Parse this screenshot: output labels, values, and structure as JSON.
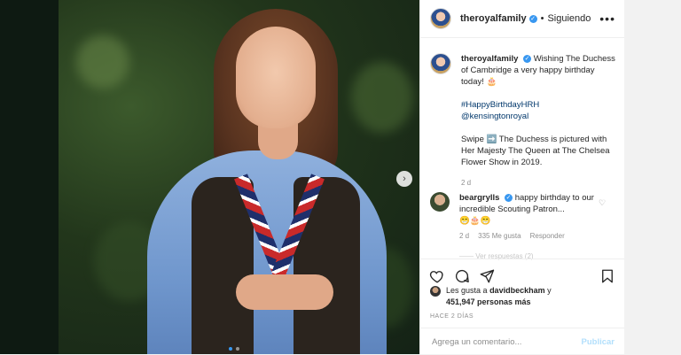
{
  "post": {
    "photo_alt": "",
    "carousel": {
      "count": 2,
      "active_index": 0
    },
    "icons": {
      "next": "chevron-right-icon"
    }
  },
  "header": {
    "username": "theroyalfamily",
    "separator": "•",
    "follow_status": "Siguiendo",
    "more_icon": "ellipsis-icon",
    "verified": true
  },
  "caption": {
    "username": "theroyalfamily",
    "text_1": "Wishing The Duchess of Cambridge a very happy birthday today! 🎂",
    "hashtag": "#HappyBirthdayHRH",
    "mention": "@kensingtonroyal",
    "text_2": "Swipe ➡️ The Duchess is pictured with Her Majesty The Queen at The Chelsea Flower Show in 2019.",
    "time": "2 d"
  },
  "comment": {
    "username": "beargrylls",
    "text": "happy birthday to our incredible Scouting Patron...",
    "emoji": "😁🎂😁",
    "time": "2 d",
    "likes": "335 Me gusta",
    "reply": "Responder",
    "view_more": "—— Ver respuestas (2)"
  },
  "actions": {
    "icons": [
      "heart-icon",
      "comment-icon",
      "share-icon",
      "bookmark-icon"
    ]
  },
  "likes": {
    "prefix": "Les gusta a",
    "user": "davidbeckham",
    "joiner": "y",
    "count": "451,947 personas más"
  },
  "posted_ago": "HACE 2 DÍAS",
  "comment_box": {
    "placeholder": "Agrega un comentario...",
    "publish": "Publicar"
  },
  "colors": {
    "accent": "#3897f0",
    "link": "#00376b",
    "muted": "#8e8e8e",
    "publish_disabled": "#b2dffc"
  }
}
